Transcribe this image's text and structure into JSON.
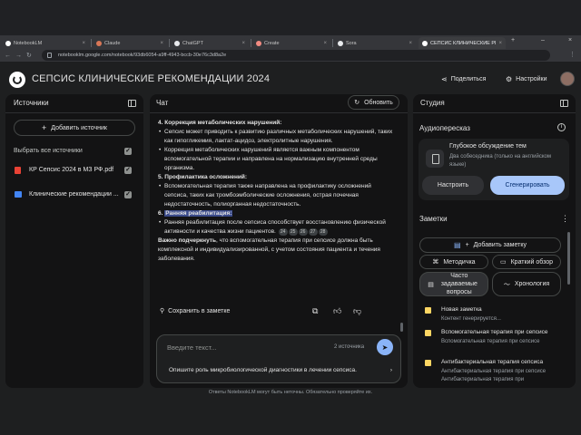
{
  "browser": {
    "tabs": [
      {
        "label": "NotebookLM",
        "color": "#ffffff"
      },
      {
        "label": "Claude",
        "color": "#d97757"
      },
      {
        "label": "ChatGPT",
        "color": "#e8eaed"
      },
      {
        "label": "Create",
        "color": "#f28b82"
      },
      {
        "label": "Sora",
        "color": "#e8eaed"
      },
      {
        "label": "СЕПСИС КЛИНИЧЕСКИЕ РЕКО...",
        "color": "#ffffff"
      }
    ],
    "new_tab": "+",
    "url": "notebooklm.google.com/notebook/93db6054-a9ff-4943-bccb-30e76c3d8a2e"
  },
  "header": {
    "title": "СЕПСИС КЛИНИЧЕСКИЕ РЕКОМЕНДАЦИИ 2024",
    "share_label": "Поделиться",
    "settings_label": "Настройки"
  },
  "sources": {
    "title": "Источники",
    "add_label": "Добавить источник",
    "select_all_label": "Выбрать все источники",
    "items": [
      {
        "label": "КР Сепсис 2024 в МЗ РФ.pdf",
        "type": "pdf-icon"
      },
      {
        "label": "Клинические рекомендации ...",
        "type": "web-icon"
      }
    ]
  },
  "chat": {
    "title": "Чат",
    "refresh_label": "Обновить",
    "content": {
      "h4": "4. Коррекция метаболических нарушений:",
      "h4_b1": "Сепсис может приводить к развитию различных метаболических нарушений, таких как гипогликемия, лактат-ацидоз, электролитные нарушения.",
      "h4_b2": "Коррекция метаболических нарушений является важным компонентом вспомогательной терапии и направлена на нормализацию внутренней среды организма.",
      "h5": "5. Профилактика осложнений:",
      "h5_b1": "Вспомогательная терапия также направлена на профилактику осложнений сепсиса, таких как тромбоэмболические осложнения, острая почечная недостаточность, полиорганная недостаточность.",
      "h6_num": "6.",
      "h6": "Ранняя реабилитация:",
      "h6_b1": "Ранняя реабилитация после сепсиса способствует восстановлению физической активности и качества жизни пациентов.",
      "cites": [
        "24",
        "25",
        "26",
        "27",
        "28"
      ],
      "final_bold": "Важно подчеркнуть",
      "final_rest": ", что вспомогательная терапия при сепсисе должна быть комплексной и индивидуализированной, с учетом состояния пациента и течения заболевания."
    },
    "save_note_label": "Сохранить в заметке",
    "input_placeholder": "Введите текст...",
    "source_count": "2 источника",
    "suggestion": "Опишите роль микробиологической диагностики в лечении сепсиса."
  },
  "studio": {
    "title": "Студия",
    "audio_title": "Аудиопересказ",
    "audio_card_title": "Глубокое обсуждение тем",
    "audio_card_sub": "Два собеседника (только на английском языке)",
    "customize_label": "Настроить",
    "generate_label": "Сгенерировать",
    "notes_title": "Заметки",
    "add_note_label": "Добавить заметку",
    "guide_label": "Методичка",
    "brief_label": "Краткий обзор",
    "faq_label": "Часто задаваемые вопросы",
    "timeline_label": "Хронология",
    "notes": [
      {
        "title": "Новая заметка",
        "sub": "Контент генерируется..."
      },
      {
        "title": "Вспомогательная терапия при сепсисе",
        "sub": "Вспомогательная терапия при сепсисе"
      },
      {
        "title": "Антибактериальная терапия сепсиса",
        "sub": "Антибактериальная терапия при сепсисе Антибактериальная терапия при"
      }
    ]
  },
  "footer": "Ответы NotebookLM могут быть неточны. Обязательно проверяйте их.",
  "colors": {
    "accent": "#8ab4f8",
    "highlight": "#3a4a8a",
    "note": "#fdd663",
    "bg": "#1e1f20",
    "panel": "#131314"
  }
}
